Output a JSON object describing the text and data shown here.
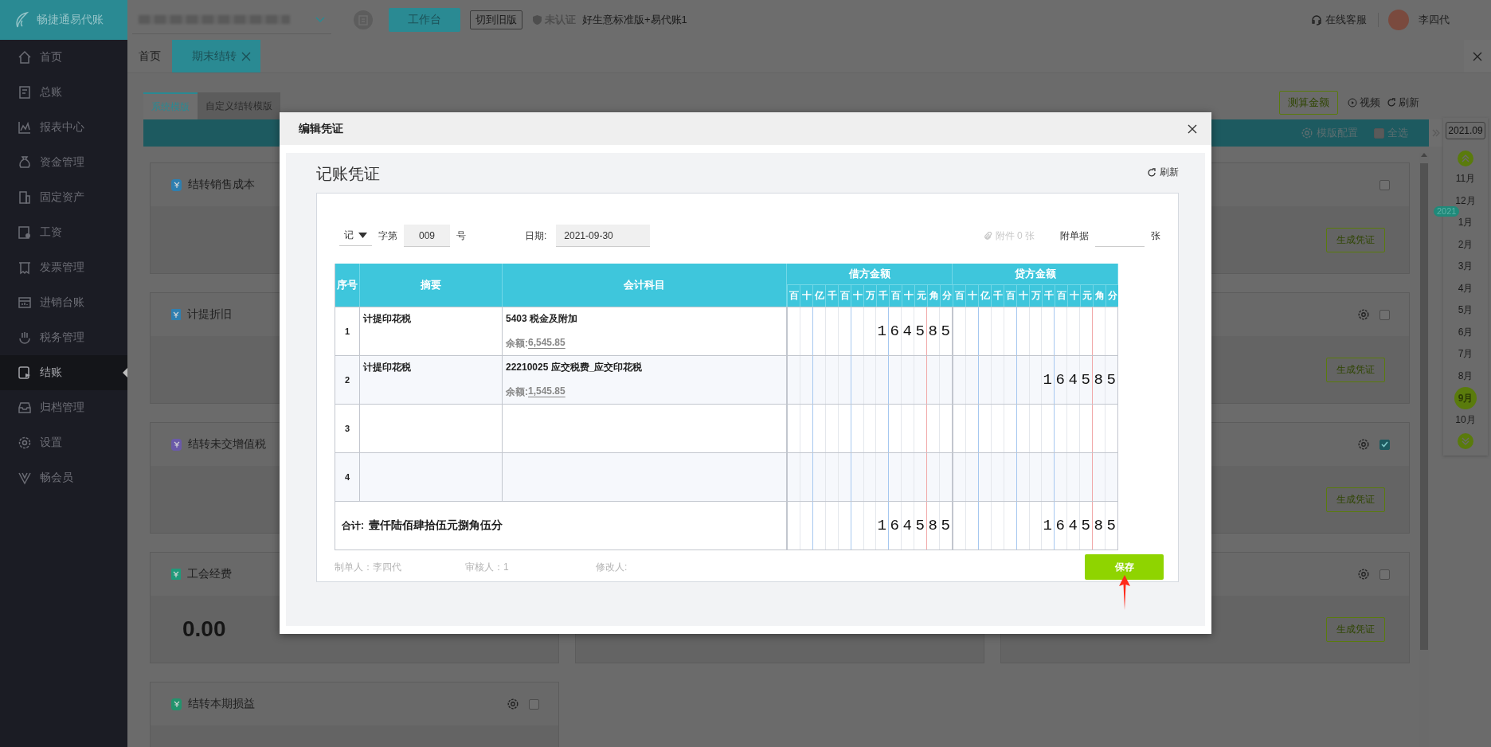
{
  "brand": {
    "name": "畅捷通易代账"
  },
  "sidebar": {
    "items": [
      {
        "label": "首页",
        "selected": false
      },
      {
        "label": "总账",
        "selected": false
      },
      {
        "label": "报表中心",
        "selected": false
      },
      {
        "label": "资金管理",
        "selected": false
      },
      {
        "label": "固定资产",
        "selected": false
      },
      {
        "label": "工资",
        "selected": false
      },
      {
        "label": "发票管理",
        "selected": false
      },
      {
        "label": "进销台账",
        "selected": false
      },
      {
        "label": "税务管理",
        "selected": false
      },
      {
        "label": "结账",
        "selected": true
      },
      {
        "label": "归档管理",
        "selected": false
      },
      {
        "label": "设置",
        "selected": false
      },
      {
        "label": "畅会员",
        "selected": false
      }
    ]
  },
  "topbar": {
    "workbench_button": "工作台",
    "old_version_button": "切到旧版",
    "certification": "未认证",
    "edition": "好生意标准版+易代账1",
    "support": "在线客服",
    "user": "李四代"
  },
  "tabs": [
    {
      "label": "首页",
      "selected": false,
      "closable": false
    },
    {
      "label": "期末结转",
      "selected": true,
      "closable": true
    }
  ],
  "subtabs": [
    {
      "label": "系统模版",
      "selected": true
    },
    {
      "label": "自定义结转模版",
      "selected": false
    }
  ],
  "actions": {
    "estimate_button": "测算金额",
    "video": "视频",
    "refresh": "刷新"
  },
  "toolbar": {
    "template_config": "模版配置",
    "select_all": {
      "label": "全选",
      "checked": false
    }
  },
  "left_cards": [
    {
      "title": "结转销售成本",
      "color": "#2e7fb0",
      "kind": "bag"
    },
    {
      "title": "计提折旧",
      "color": "#2f7fb0",
      "kind": "doc"
    },
    {
      "title": "结转未交增值税",
      "color": "#6a5aa8",
      "kind": "bag"
    },
    {
      "title": "工会经费",
      "color": "#1f9a7a",
      "kind": "doc",
      "amount": "0.00"
    },
    {
      "title": "结转本期损益",
      "color": "#23936d",
      "kind": "bag",
      "settings": true,
      "checked": false
    }
  ],
  "right_cards": [
    {
      "settings": false,
      "checked": false,
      "button": "生成凭证"
    },
    {
      "settings": true,
      "checked": false,
      "button": "生成凭证"
    },
    {
      "settings": true,
      "checked": true,
      "button": "生成凭证"
    },
    {
      "settings": true,
      "checked": false,
      "button": "生成凭证"
    }
  ],
  "calendar": {
    "period": "2021.09",
    "year_badge": "2021",
    "months": [
      {
        "label": "11月",
        "selected": false
      },
      {
        "label": "12月",
        "selected": false
      },
      {
        "label": "1月",
        "selected": false
      },
      {
        "label": "2月",
        "selected": false
      },
      {
        "label": "3月",
        "selected": false
      },
      {
        "label": "4月",
        "selected": false
      },
      {
        "label": "5月",
        "selected": false
      },
      {
        "label": "6月",
        "selected": false
      },
      {
        "label": "7月",
        "selected": false
      },
      {
        "label": "8月",
        "selected": false
      },
      {
        "label": "9月",
        "selected": true
      },
      {
        "label": "10月",
        "selected": false
      }
    ]
  },
  "dialog": {
    "title": "编辑凭证",
    "heading": "记账凭证",
    "refresh": "刷新",
    "voucher_type": "记",
    "number_prefix": "字第",
    "number": "009",
    "number_suffix": "号",
    "date_label": "日期:",
    "date": "2021-09-30",
    "attachments": {
      "label": "附件 0 张",
      "disabled": true
    },
    "receipts_label": "附单据",
    "receipts_unit": "张",
    "columns": {
      "index": "序号",
      "summary": "摘要",
      "account": "会计科目",
      "debit": "借方金额",
      "credit": "贷方金额",
      "debit_digits": [
        "百",
        "十",
        "亿",
        "千",
        "百",
        "十",
        "万",
        "千",
        "百",
        "十",
        "元",
        "角",
        "分"
      ],
      "credit_digits": [
        "百",
        "十",
        "亿",
        "千",
        "百",
        "十",
        "万",
        "千",
        "百",
        "十",
        "元",
        "角",
        "分"
      ]
    },
    "rows": [
      {
        "index": "1",
        "summary": "计提印花税",
        "account": "5403 税金及附加",
        "balance_label": "余额:",
        "balance": "6,545.85",
        "debit": "164585"
      },
      {
        "index": "2",
        "summary": "计提印花税",
        "account": "22210025 应交税费_应交印花税",
        "balance_label": "余额:",
        "balance": "1,545.85",
        "credit": "164585"
      },
      {
        "index": "3"
      },
      {
        "index": "4"
      }
    ],
    "total": {
      "label": "合计:",
      "words": "壹仟陆佰肆拾伍元捌角伍分",
      "debit": "164585",
      "credit": "164585"
    },
    "preparer": "制单人：李四代",
    "reviewer": "审核人：1",
    "modifier": "修改人:",
    "save_button": "保存"
  }
}
